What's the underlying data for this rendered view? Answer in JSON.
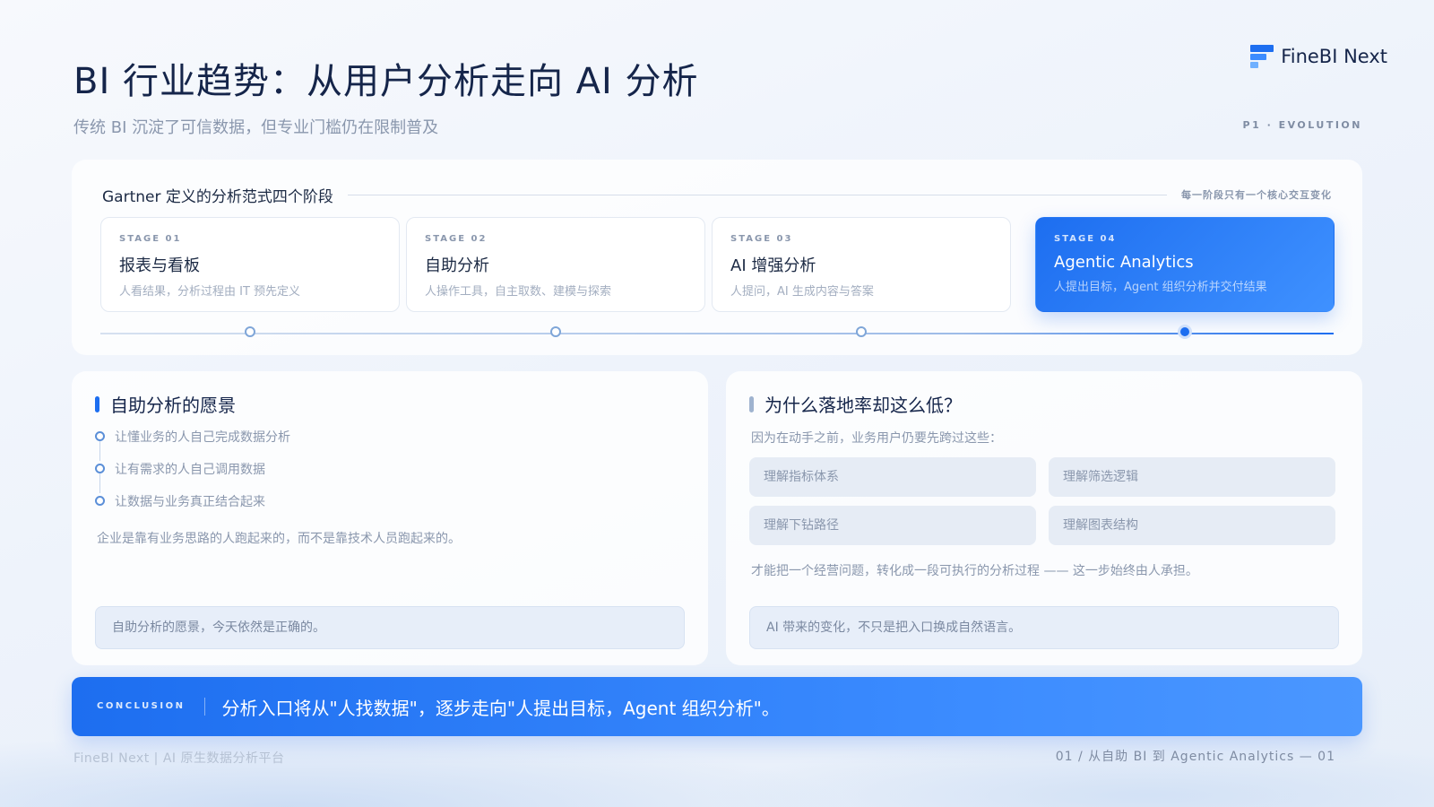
{
  "header": {
    "title": "BI 行业趋势：从用户分析走向 AI 分析",
    "subtitle": "传统 BI 沉淀了可信数据，但专业门槛仍在限制普及",
    "logo_text": "FineBI Next",
    "page_tag": "P1 · EVOLUTION"
  },
  "stages": {
    "title": "Gartner 定义的分析范式四个阶段",
    "note": "每一阶段只有一个核心交互变化",
    "items": [
      {
        "code": "STAGE 01",
        "name": "报表与看板",
        "desc": "人看结果，分析过程由 IT 预先定义"
      },
      {
        "code": "STAGE 02",
        "name": "自助分析",
        "desc": "人操作工具，自主取数、建模与探索"
      },
      {
        "code": "STAGE 03",
        "name": "AI 增强分析",
        "desc": "人提问，AI 生成内容与答案"
      },
      {
        "code": "STAGE 04",
        "name": "Agentic Analytics",
        "desc": "人提出目标，Agent 组织分析并交付结果"
      }
    ],
    "active_index": 3
  },
  "vision": {
    "title": "自助分析的愿景",
    "items": [
      "让懂业务的人自己完成数据分析",
      "让有需求的人自己调用数据",
      "让数据与业务真正结合起来"
    ],
    "note": "企业是靠有业务思路的人跑起来的，而不是靠技术人员跑起来的。",
    "callout": "自助分析的愿景，今天依然是正确的。"
  },
  "why": {
    "title": "为什么落地率却这么低？",
    "intro": "因为在动手之前，业务用户仍要先跨过这些：",
    "chips": [
      "理解指标体系",
      "理解筛选逻辑",
      "理解下钻路径",
      "理解图表结构"
    ],
    "outro": "才能把一个经营问题，转化成一段可执行的分析过程 —— 这一步始终由人承担。",
    "callout": "AI 带来的变化，不只是把入口换成自然语言。"
  },
  "conclusion": {
    "tag": "CONCLUSION",
    "text": "分析入口将从\"人找数据\"，逐步走向\"人提出目标，Agent 组织分析\"。"
  },
  "footer": {
    "left": "FineBI Next | AI 原生数据分析平台",
    "right": "01 / 从自助 BI 到 Agentic Analytics — 01"
  },
  "colors": {
    "accent": "#1d6ef0",
    "title": "#15254a",
    "muted": "#8a97ad"
  }
}
